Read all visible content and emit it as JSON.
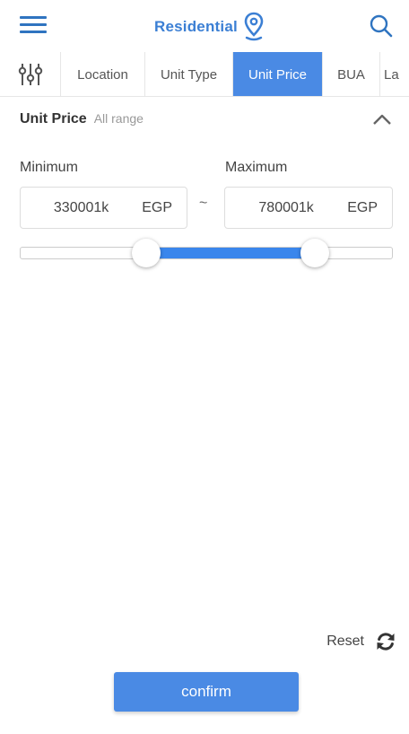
{
  "header": {
    "title": "Residential",
    "menu_icon": "hamburger-menu-icon",
    "location_icon": "map-pin-icon",
    "search_icon": "search-icon",
    "accent": "#3b7fd4"
  },
  "tabs": {
    "filter_icon": "sliders-icon",
    "items": [
      {
        "label": "Location"
      },
      {
        "label": "Unit Type"
      },
      {
        "label": "Unit Price",
        "active": true
      },
      {
        "label": "BUA"
      },
      {
        "label": "La"
      }
    ],
    "active_color": "#4a8ae4"
  },
  "price_filter": {
    "title": "Unit Price",
    "subtitle": "All range",
    "collapse_icon": "chevron-up-icon",
    "minimum": {
      "label": "Minimum",
      "value": "330001k",
      "currency": "EGP"
    },
    "separator": "~",
    "maximum": {
      "label": "Maximum",
      "value": "780001k",
      "currency": "EGP"
    },
    "slider": {
      "min_fraction": 0.34,
      "max_fraction": 0.79,
      "fill_color": "#3a86ec"
    }
  },
  "footer": {
    "reset_label": "Reset",
    "reset_icon": "refresh-icon",
    "confirm_label": "confirm"
  }
}
